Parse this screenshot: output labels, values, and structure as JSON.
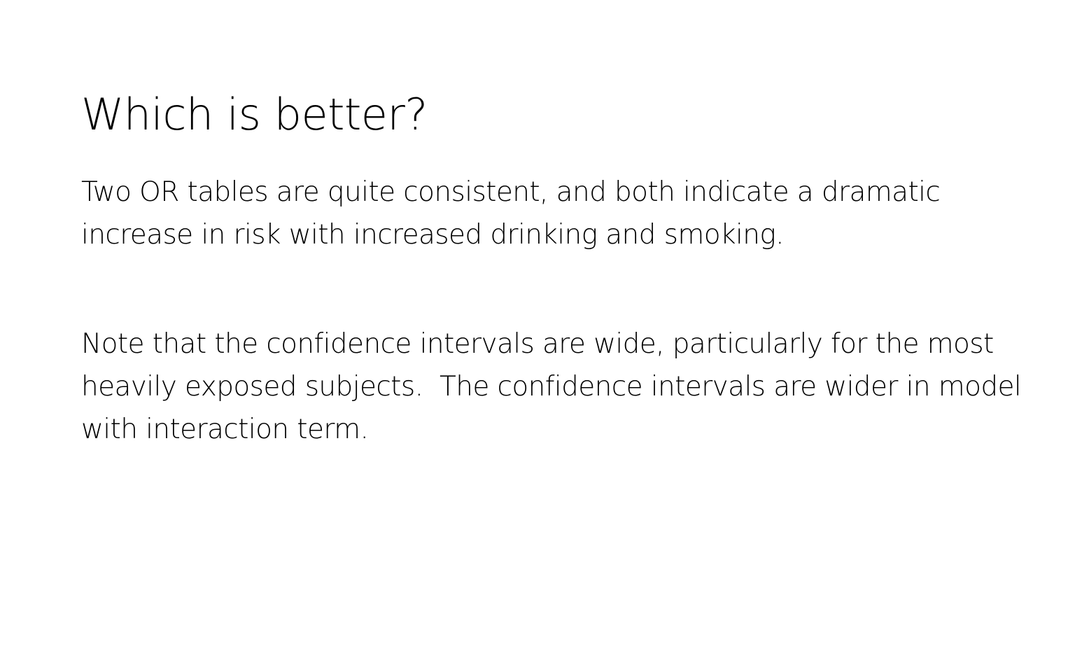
{
  "slide": {
    "title": "Which is better?",
    "paragraphs": [
      "Two OR tables are quite consistent, and both indicate a dramatic increase in risk with increased drinking and smoking.",
      "Note that the confidence intervals are wide, particularly for the most heavily exposed subjects.  The confidence intervals are wider in model with interaction term."
    ]
  }
}
